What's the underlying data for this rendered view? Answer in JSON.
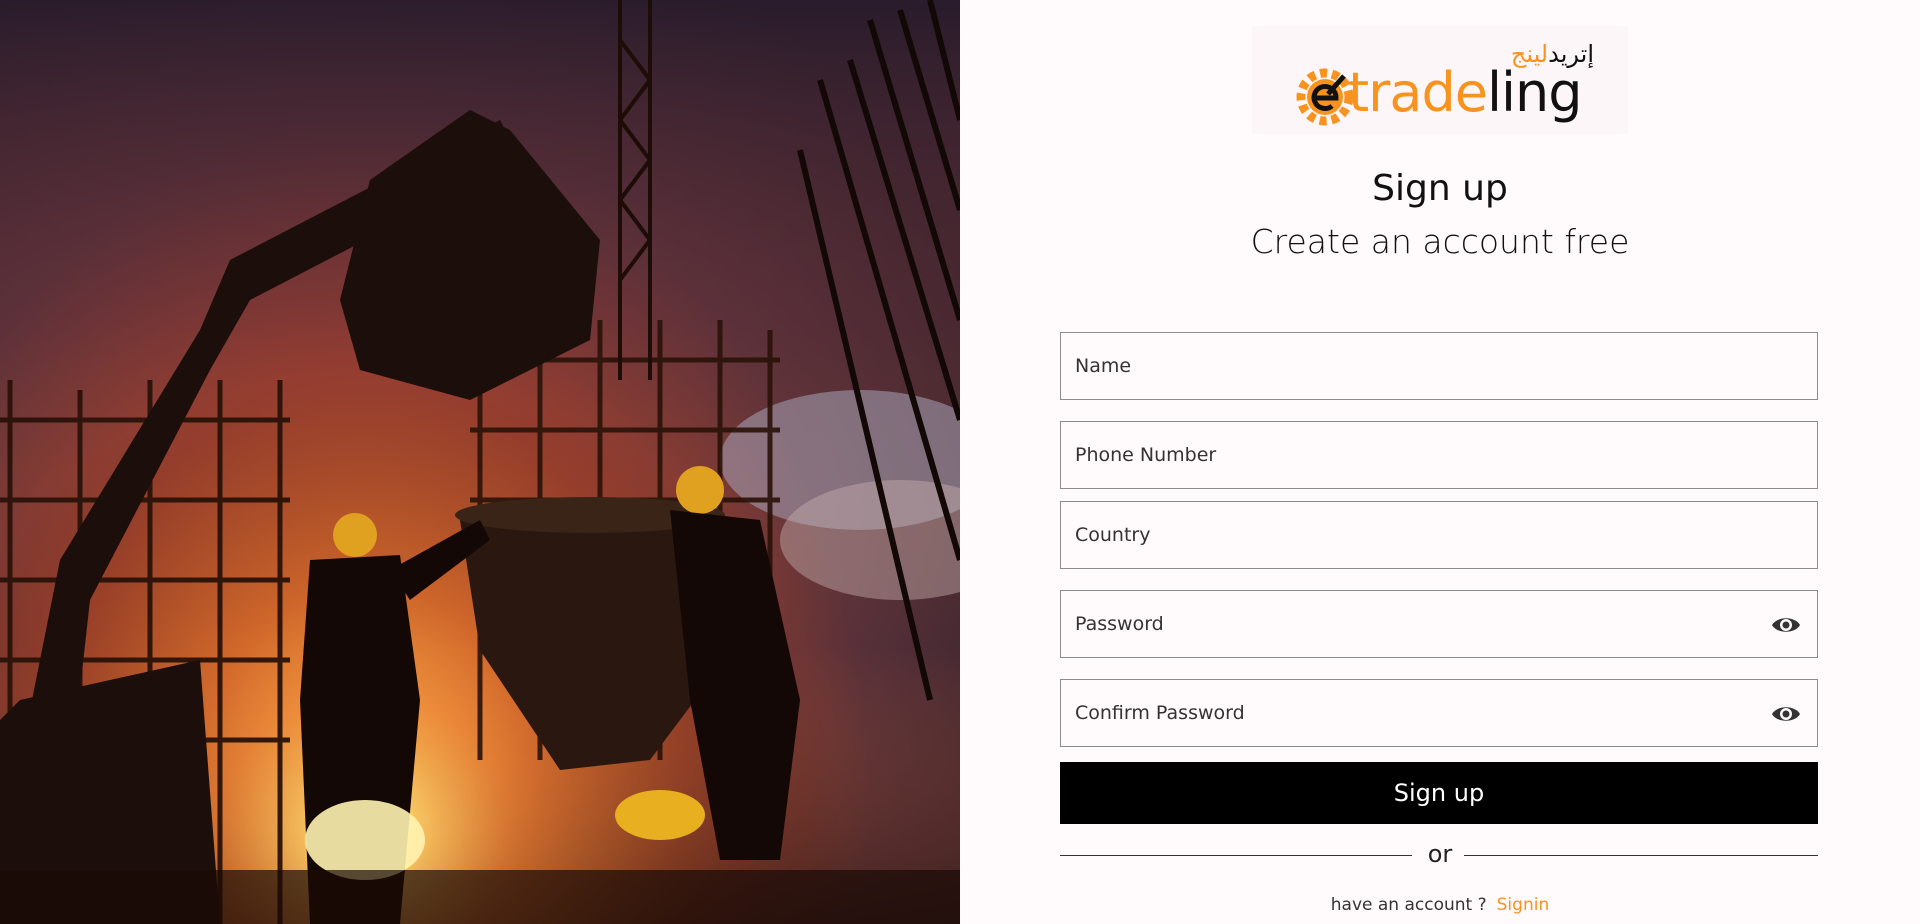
{
  "logo": {
    "arabic_text_dark": "إتريد",
    "arabic_text_accent": "لينج",
    "word_orange": "trade",
    "word_dark": "ling",
    "icon": "gear-e-icon",
    "colors": {
      "orange": "#f7931e",
      "dark": "#111111"
    }
  },
  "header": {
    "title": "Sign up",
    "subtitle": "Create an account free"
  },
  "form": {
    "name_placeholder": "Name",
    "phone_placeholder": "Phone Number",
    "country_placeholder": "Country",
    "password_placeholder": "Password",
    "confirm_password_placeholder": "Confirm Password",
    "password_toggle_icon": "eye-icon",
    "submit_label": "Sign up"
  },
  "divider": {
    "label": "or"
  },
  "footer": {
    "prompt": "have an account ?",
    "signin_label": "Signin"
  },
  "hero": {
    "alt": "construction-site-image"
  },
  "colors": {
    "accent": "#f7931e",
    "button_bg": "#000000",
    "page_bg": "#fffafc",
    "field_border": "#8c8c8c"
  }
}
